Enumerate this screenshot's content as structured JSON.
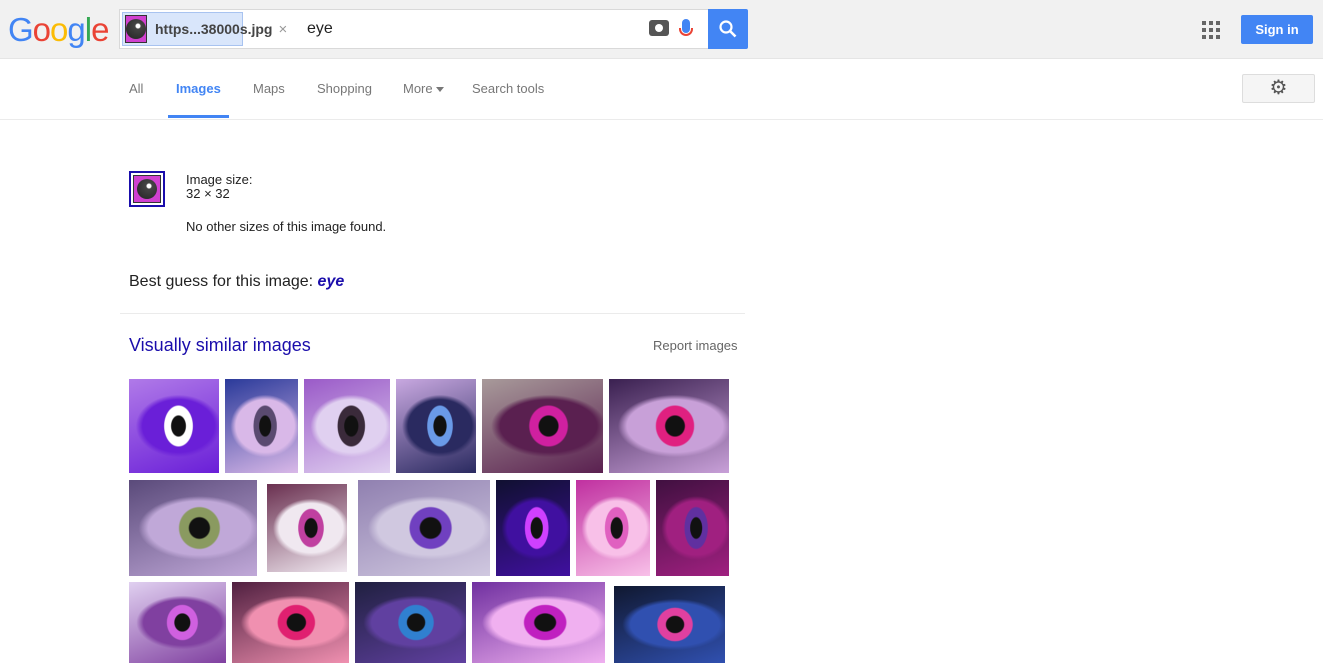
{
  "logo": "Google",
  "search": {
    "image_chip": "https...38000s.jpg",
    "query": "eye",
    "close": "×"
  },
  "header": {
    "sign_in": "Sign in"
  },
  "nav": {
    "tabs": [
      "All",
      "Images",
      "Maps",
      "Shopping",
      "More",
      "Search tools"
    ]
  },
  "result": {
    "size_label": "Image size:",
    "size_value": "32 × 32",
    "no_sizes": "No other sizes of this image found.",
    "best_guess_label": "Best guess for this image:",
    "best_guess": "eye"
  },
  "similar": {
    "title": "Visually similar images",
    "report": "Report images",
    "images": [
      {
        "c1": "#ffffff",
        "c2": "#6a1fd8",
        "c3": "#b07ae8"
      },
      {
        "c1": "#5a4a70",
        "c2": "#d9b8e8",
        "c3": "#2a3a9a"
      },
      {
        "c1": "#3a2a3a",
        "c2": "#e0d0f0",
        "c3": "#9a5ac8"
      },
      {
        "c1": "#6a9ae8",
        "c2": "#2a2a60",
        "c3": "#c8a8e0"
      },
      {
        "c1": "#d020a0",
        "c2": "#5a2050",
        "c3": "#a89a9a"
      },
      {
        "c1": "#e02080",
        "c2": "#c8a0d8",
        "c3": "#3a2050"
      },
      {
        "c1": "#8a9a60",
        "c2": "#c0a8d8",
        "c3": "#5a4a7a"
      },
      {
        "c1": "#c040a0",
        "c2": "#f0e8f0",
        "c3": "#6a3050"
      },
      {
        "c1": "#7040c0",
        "c2": "#d0c8e0",
        "c3": "#9080b0"
      },
      {
        "c1": "#d040ff",
        "c2": "#4010a0",
        "c3": "#101030"
      },
      {
        "c1": "#e060c0",
        "c2": "#f8c0e8",
        "c3": "#c030a0"
      },
      {
        "c1": "#6030a0",
        "c2": "#a02080",
        "c3": "#401040"
      },
      {
        "c1": "#d060e0",
        "c2": "#8040a0",
        "c3": "#e0d0f0"
      },
      {
        "c1": "#e02070",
        "c2": "#f090b0",
        "c3": "#502040"
      },
      {
        "c1": "#3080d0",
        "c2": "#6040a0",
        "c3": "#202040"
      },
      {
        "c1": "#c020c0",
        "c2": "#f0b0f0",
        "c3": "#7030a0"
      },
      {
        "c1": "#e040a0",
        "c2": "#3050b0",
        "c3": "#101830"
      }
    ]
  }
}
